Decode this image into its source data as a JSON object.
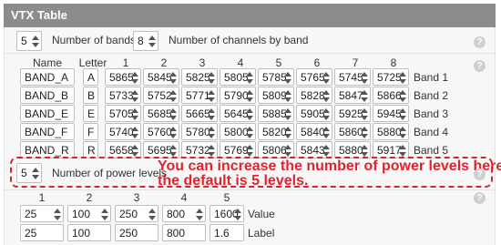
{
  "title": "VTX Table",
  "bands_count": {
    "value": "5",
    "label": "Number of bands"
  },
  "channels_count": {
    "value": "8",
    "label": "Number of channels by band"
  },
  "columns": {
    "name": "Name",
    "letter": "Letter",
    "channels": [
      "1",
      "2",
      "3",
      "4",
      "5",
      "6",
      "7",
      "8"
    ]
  },
  "bands": [
    {
      "name": "BAND_A",
      "letter": "A",
      "freqs": [
        "5865",
        "5845",
        "5825",
        "5805",
        "5785",
        "5765",
        "5745",
        "5725"
      ],
      "label": "Band 1"
    },
    {
      "name": "BAND_B",
      "letter": "B",
      "freqs": [
        "5733",
        "5752",
        "5771",
        "5790",
        "5809",
        "5828",
        "5847",
        "5866"
      ],
      "label": "Band 2"
    },
    {
      "name": "BAND_E",
      "letter": "E",
      "freqs": [
        "5705",
        "5685",
        "5665",
        "5645",
        "5885",
        "5905",
        "5925",
        "5945"
      ],
      "label": "Band 3"
    },
    {
      "name": "BAND_F",
      "letter": "F",
      "freqs": [
        "5740",
        "5760",
        "5780",
        "5800",
        "5820",
        "5840",
        "5860",
        "5880"
      ],
      "label": "Band 4"
    },
    {
      "name": "BAND_R",
      "letter": "R",
      "freqs": [
        "5658",
        "5695",
        "5732",
        "5769",
        "5806",
        "5843",
        "5880",
        "5917"
      ],
      "label": "Band 5"
    }
  ],
  "power_levels": {
    "value": "5",
    "label": "Number of power levels"
  },
  "annotation": {
    "line1": "You can increase the number of power levels here;",
    "line2": "the default is 5 levels."
  },
  "power_columns": [
    "1",
    "2",
    "3",
    "4",
    "5"
  ],
  "power_values": [
    "25",
    "100",
    "250",
    "800",
    "1600"
  ],
  "power_value_label": "Value",
  "power_labels": [
    "25",
    "100",
    "250",
    "800",
    "1.6"
  ],
  "power_label_label": "Label",
  "help_icon": "?",
  "accent_color": "#e0232f"
}
